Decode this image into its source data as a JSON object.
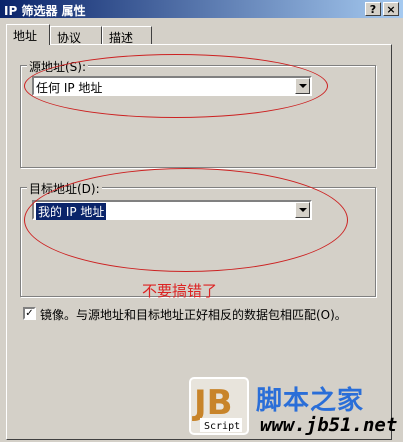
{
  "window": {
    "title": "IP 筛选器 属性",
    "help_btn": "?",
    "close_btn": "×"
  },
  "tabs": [
    "地址",
    "协议",
    "描述"
  ],
  "source": {
    "label": "源地址(S):",
    "value": "任何 IP 地址"
  },
  "destination": {
    "label": "目标地址(D):",
    "value": "我的 IP 地址"
  },
  "annotation": "不要搞错了",
  "mirror": {
    "checked": true,
    "label": "镜像。与源地址和目标地址正好相反的数据包相匹配(O)。"
  },
  "watermark": {
    "logo_letters": "JB",
    "script_text": "Script",
    "site_name": "脚本之家",
    "site_url": "www.jb51.net"
  },
  "colors": {
    "annotation_red": "#dd2222",
    "titlebar": "#0a246a"
  }
}
